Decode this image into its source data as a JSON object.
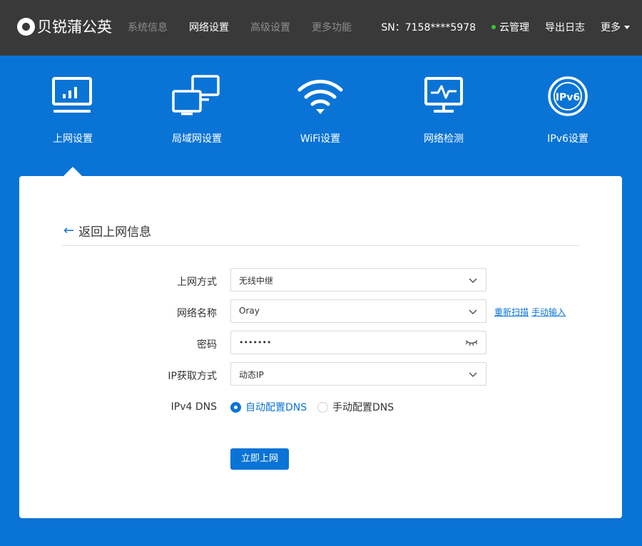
{
  "header": {
    "brand": "贝锐蒲公英",
    "nav": [
      {
        "label": "系统信息",
        "active": false
      },
      {
        "label": "网络设置",
        "active": true
      },
      {
        "label": "高级设置",
        "active": false
      },
      {
        "label": "更多功能",
        "active": false
      }
    ],
    "sn": "SN：7158****5978",
    "cloud": "云管理",
    "cloud_status_color": "#34c634",
    "export_log": "导出日志",
    "more": "更多"
  },
  "features": [
    {
      "label": "上网设置",
      "icon": "monitor-chart-icon",
      "active": true
    },
    {
      "label": "局域网设置",
      "icon": "lan-computers-icon",
      "active": false
    },
    {
      "label": "WiFi设置",
      "icon": "wifi-icon",
      "active": false
    },
    {
      "label": "网络检测",
      "icon": "network-detect-icon",
      "active": false
    },
    {
      "label": "IPv6设置",
      "icon": "ipv6-icon",
      "icon_text": "IPv6",
      "active": false
    }
  ],
  "panel": {
    "back": "返回上网信息",
    "form": {
      "mode_label": "上网方式",
      "mode_value": "无线中继",
      "ssid_label": "网络名称",
      "ssid_value": "Oray",
      "rescan": "重新扫描",
      "manual_input": "手动输入",
      "password_label": "密码",
      "password_value": "•••••••",
      "ip_label": "IP获取方式",
      "ip_value": "动态IP",
      "dns_label": "IPv4 DNS",
      "dns_auto": "自动配置DNS",
      "dns_manual": "手动配置DNS",
      "dns_selected": "auto",
      "submit": "立即上网"
    }
  },
  "colors": {
    "accent": "#0a74d6",
    "topbar": "#393939",
    "panel": "#ffffff"
  }
}
